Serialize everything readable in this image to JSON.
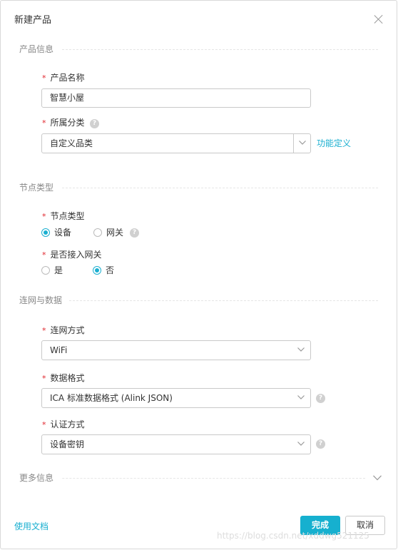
{
  "dialog": {
    "title": "新建产品"
  },
  "sections": {
    "product_info": "产品信息",
    "node_type": "节点类型",
    "network_data": "连网与数据",
    "more_info": "更多信息"
  },
  "form": {
    "required_mark": "*",
    "product_name": {
      "label": "产品名称",
      "value": "智慧小屋"
    },
    "category": {
      "label": "所属分类",
      "value": "自定义品类",
      "link": "功能定义"
    },
    "node_type": {
      "label": "节点类型",
      "options": [
        "设备",
        "网关"
      ],
      "selected": "设备"
    },
    "gateway_access": {
      "label": "是否接入网关",
      "options": [
        "是",
        "否"
      ],
      "selected": "否"
    },
    "network_method": {
      "label": "连网方式",
      "value": "WiFi"
    },
    "data_format": {
      "label": "数据格式",
      "value": "ICA 标准数据格式 (Alink JSON)"
    },
    "auth_method": {
      "label": "认证方式",
      "value": "设备密钥"
    }
  },
  "icons": {
    "help": "?",
    "close": "close-icon",
    "chevron": "chevron-down-icon"
  },
  "footer": {
    "doc_link": "使用文档",
    "confirm": "完成",
    "cancel": "取消"
  },
  "watermark": "https://blog.csdn.net/xddwg521125",
  "colors": {
    "accent": "#1aafd0",
    "required": "#e0262d"
  }
}
